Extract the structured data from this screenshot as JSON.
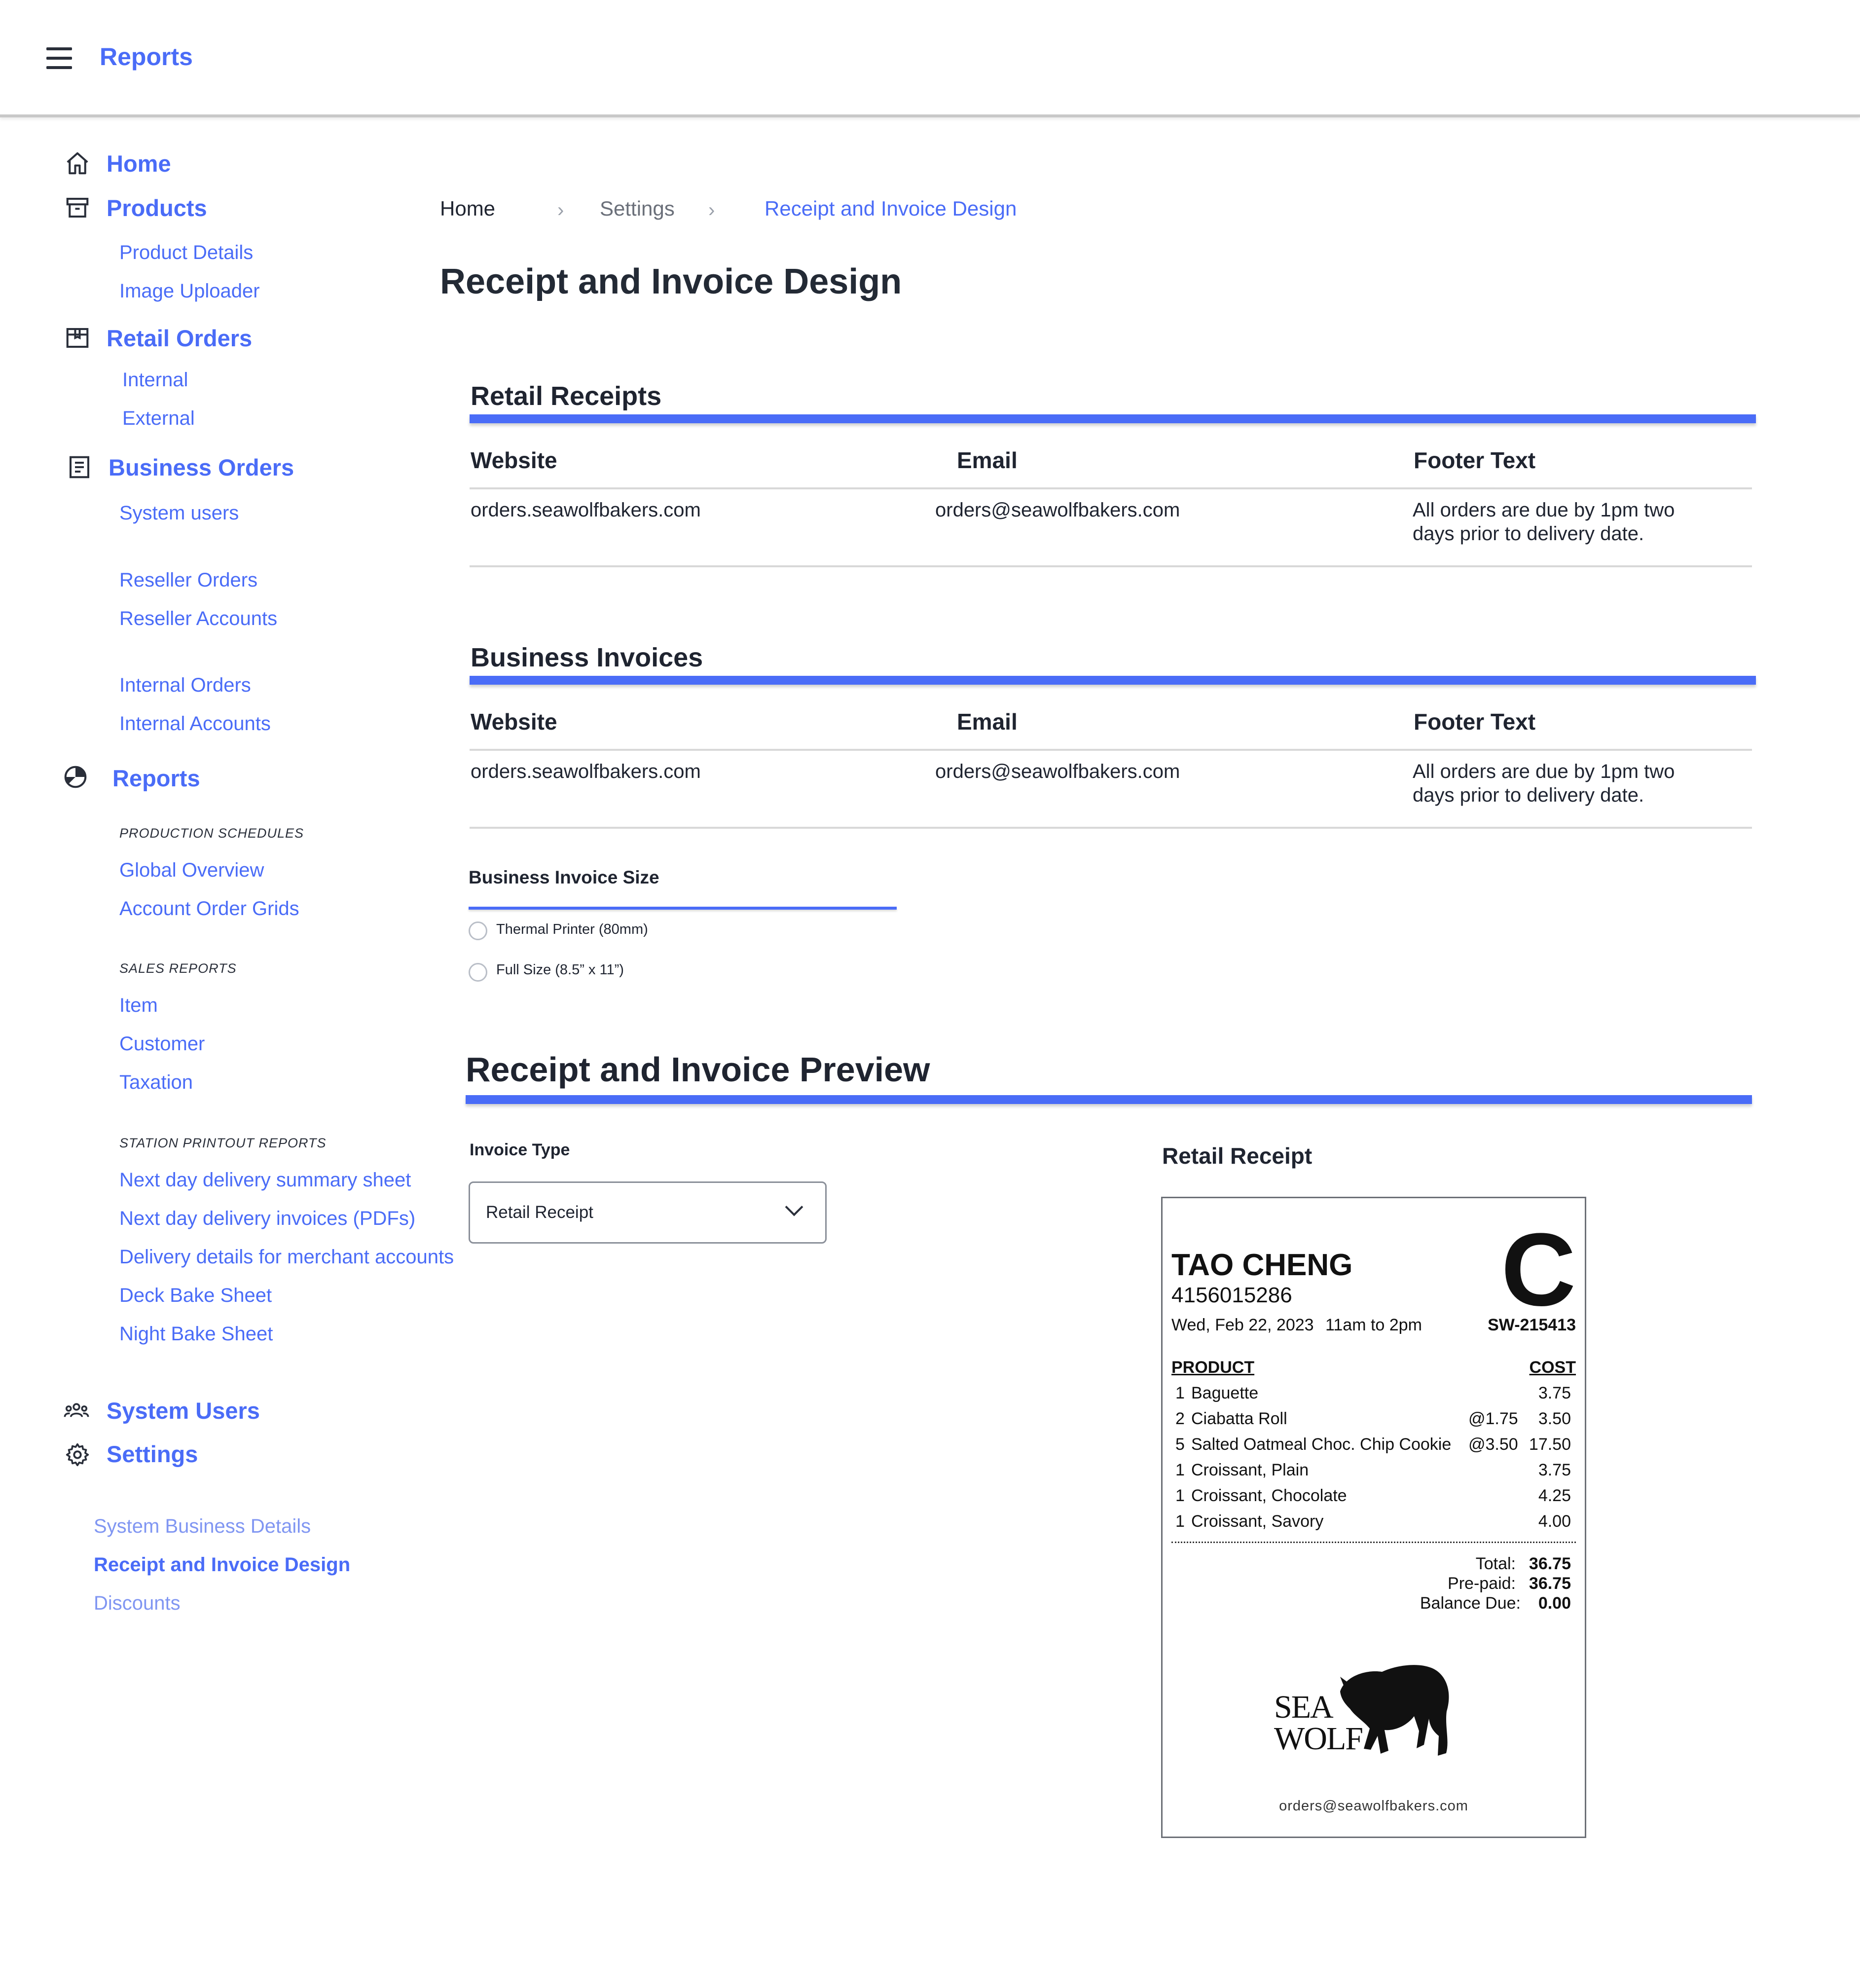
{
  "app": {
    "title": "Reports",
    "menu_icon": "hamburger-menu-icon"
  },
  "sidebar": {
    "home": "Home",
    "products": {
      "label": "Products",
      "items": [
        "Product Details",
        "Image Uploader"
      ]
    },
    "retail_orders": {
      "label": "Retail Orders",
      "items": [
        "Internal",
        "External"
      ]
    },
    "business_orders": {
      "label": "Business Orders",
      "items": [
        "System users",
        "Reseller Orders",
        "Reseller Accounts",
        "Internal Orders",
        "Internal Accounts"
      ]
    },
    "reports": {
      "label": "Reports",
      "groups": [
        {
          "title": "PRODUCTION SCHEDULES",
          "items": [
            "Global Overview",
            "Account Order Grids"
          ]
        },
        {
          "title": "SALES REPORTS",
          "items": [
            "Item",
            "Customer",
            "Taxation"
          ]
        },
        {
          "title": "STATION PRINTOUT REPORTS",
          "items": [
            "Next day delivery summary sheet",
            "Next day delivery invoices (PDFs)",
            "Delivery details for merchant accounts",
            "Deck Bake Sheet",
            "Night Bake Sheet"
          ]
        }
      ]
    },
    "system_users": "System Users",
    "settings": {
      "label": "Settings",
      "items": [
        "System Business Details",
        "Receipt and Invoice Design",
        "Discounts"
      ]
    }
  },
  "breadcrumb": [
    "Home",
    "Settings",
    "Receipt and Invoice Design"
  ],
  "page_title": "Receipt and Invoice Design",
  "retail_receipts": {
    "title": "Retail Receipts",
    "columns": [
      "Website",
      "Email",
      "Footer Text"
    ],
    "row": {
      "website": "orders.seawolfbakers.com",
      "email": "orders@seawolfbakers.com",
      "footer_line1": "All orders are due by 1pm two",
      "footer_line2": "days prior to delivery date."
    }
  },
  "business_invoices": {
    "title": "Business Invoices",
    "columns": [
      "Website",
      "Email",
      "Footer Text"
    ],
    "row": {
      "website": "orders.seawolfbakers.com",
      "email": "orders@seawolfbakers.com",
      "footer_line1": "All orders are due by 1pm two",
      "footer_line2": "days prior to delivery date."
    }
  },
  "invoice_size": {
    "label": "Business Invoice Size",
    "options": [
      "Thermal Printer (80mm)",
      "Full Size (8.5” x 11”)"
    ]
  },
  "preview": {
    "title": "Receipt and Invoice Preview",
    "invoice_type_label": "Invoice Type",
    "invoice_type_value": "Retail Receipt",
    "receipt_heading": "Retail Receipt"
  },
  "receipt": {
    "customer": "TAO CHENG",
    "phone": "4156015286",
    "date": "Wed, Feb 22, 2023",
    "window": "11am to 2pm",
    "letter": "C",
    "order_id": "SW-215413",
    "col_product": "PRODUCT",
    "col_cost": "COST",
    "items": [
      {
        "qty": "1",
        "name": "Baguette",
        "unit": "",
        "cost": "3.75"
      },
      {
        "qty": "2",
        "name": "Ciabatta Roll",
        "unit": "@1.75",
        "cost": "3.50"
      },
      {
        "qty": "5",
        "name": "Salted Oatmeal Choc. Chip Cookie",
        "unit": "@3.50",
        "cost": "17.50"
      },
      {
        "qty": "1",
        "name": "Croissant, Plain",
        "unit": "",
        "cost": "3.75"
      },
      {
        "qty": "1",
        "name": "Croissant, Chocolate",
        "unit": "",
        "cost": "4.25"
      },
      {
        "qty": "1",
        "name": "Croissant, Savory",
        "unit": "",
        "cost": "4.00"
      }
    ],
    "total_label": "Total:",
    "total": "36.75",
    "prepaid_label": "Pre-paid:",
    "prepaid": "36.75",
    "balance_label": "Balance Due:",
    "balance": "0.00",
    "logo_line1": "SEA",
    "logo_line2": "WOLF",
    "email": "orders@seawolfbakers.com"
  },
  "colors": {
    "accent": "#4a6cf7",
    "text": "#1f2430",
    "divider": "#d8d8d8"
  }
}
